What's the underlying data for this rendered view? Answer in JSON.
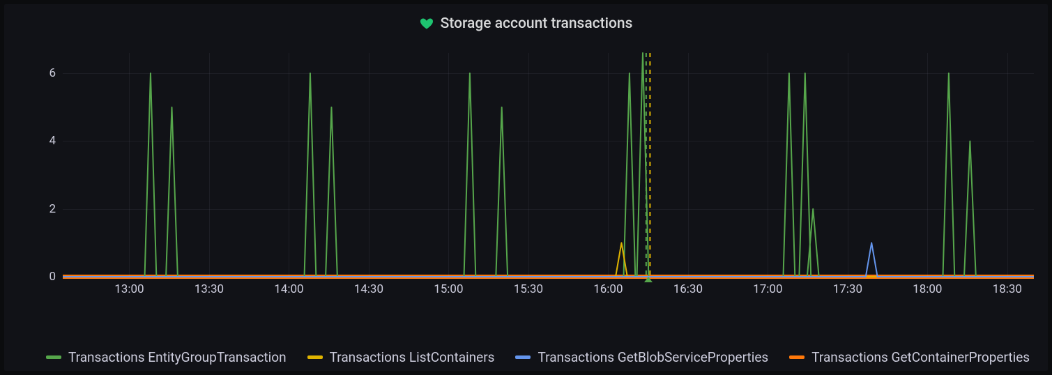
{
  "title": "Storage account transactions",
  "title_icon": "heart",
  "colors": {
    "bg": "#111217",
    "text": "#ccccdc",
    "grid": "rgba(204,204,220,.07)",
    "heart": "#1ec370"
  },
  "axis": {
    "x_ticks": [
      "13:00",
      "13:30",
      "14:00",
      "14:30",
      "15:00",
      "15:30",
      "16:00",
      "16:30",
      "17:00",
      "17:30",
      "18:00",
      "18:30"
    ],
    "y_ticks": [
      0,
      2,
      4,
      6
    ],
    "y_min": 0,
    "y_max": 6.6,
    "x_min_min": 755,
    "x_max_min": 1120
  },
  "legend": [
    {
      "name": "Transactions EntityGroupTransaction",
      "color": "#56a64b"
    },
    {
      "name": "Transactions ListContainers",
      "color": "#e0b400"
    },
    {
      "name": "Transactions GetBlobServiceProperties",
      "color": "#6495ed"
    },
    {
      "name": "Transactions GetContainerProperties",
      "color": "#ff780a"
    }
  ],
  "annotation": {
    "time_min": 975,
    "color_a": "#56a64b",
    "color_b": "#e0b400"
  },
  "chart_data": {
    "type": "line",
    "title": "Storage account transactions",
    "xlabel": "",
    "ylabel": "",
    "ylim": [
      0,
      6.6
    ],
    "x_unit": "minutes_since_midnight",
    "series": [
      {
        "name": "Transactions EntityGroupTransaction",
        "color": "#56a64b",
        "spikes": [
          {
            "t": 788,
            "v": 6
          },
          {
            "t": 796,
            "v": 5
          },
          {
            "t": 848,
            "v": 6
          },
          {
            "t": 856,
            "v": 5
          },
          {
            "t": 908,
            "v": 6
          },
          {
            "t": 920,
            "v": 5
          },
          {
            "t": 968,
            "v": 6
          },
          {
            "t": 973,
            "v": 6.6
          },
          {
            "t": 1028,
            "v": 6
          },
          {
            "t": 1034,
            "v": 6
          },
          {
            "t": 1037,
            "v": 2
          },
          {
            "t": 1088,
            "v": 6
          },
          {
            "t": 1096,
            "v": 4
          }
        ]
      },
      {
        "name": "Transactions ListContainers",
        "color": "#e0b400",
        "spikes": [
          {
            "t": 965,
            "v": 1
          }
        ]
      },
      {
        "name": "Transactions GetBlobServiceProperties",
        "color": "#6495ed",
        "spikes": [
          {
            "t": 1059,
            "v": 1
          }
        ]
      },
      {
        "name": "Transactions GetContainerProperties",
        "color": "#ff780a",
        "spikes": []
      }
    ]
  }
}
